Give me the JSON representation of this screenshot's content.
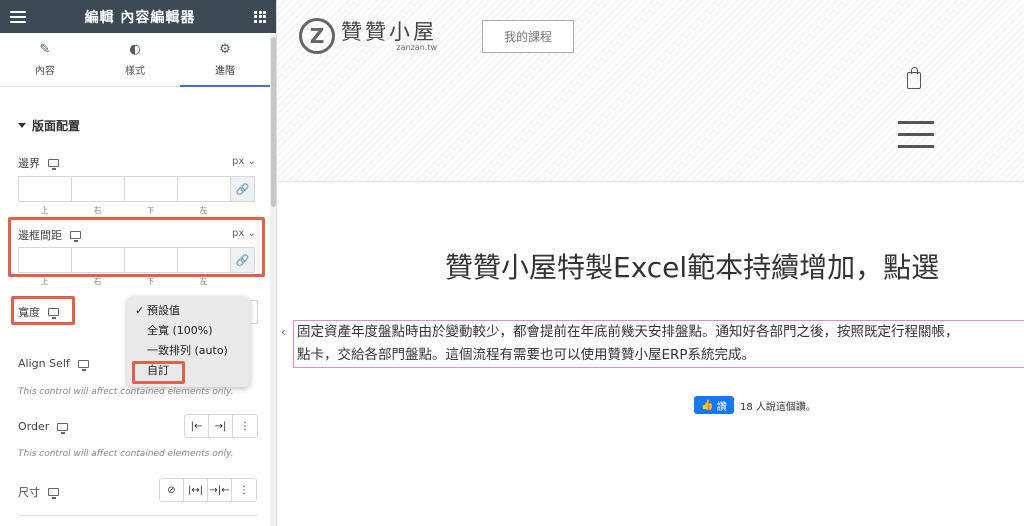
{
  "panel": {
    "title": "編輯 內容編輯器",
    "tabs": [
      {
        "label": "內容"
      },
      {
        "label": "樣式"
      },
      {
        "label": "進階"
      }
    ],
    "section_title": "版面配置",
    "margin": {
      "label": "邊界",
      "unit": "px ⌄",
      "sides": [
        "上",
        "右",
        "下",
        "左"
      ]
    },
    "padding": {
      "label": "邊框間距",
      "unit": "px ⌄",
      "sides": [
        "上",
        "右",
        "下",
        "左"
      ]
    },
    "width": {
      "label": "寬度",
      "options": [
        "預設值",
        "全寬 (100%)",
        "一致排列 (auto)",
        "自訂"
      ],
      "checked": "預設值",
      "highlighted": "自訂"
    },
    "align_self": {
      "label": "Align Self",
      "note": "This control will affect contained elements only."
    },
    "order": {
      "label": "Order",
      "note": "This control will affect contained elements only."
    },
    "size": {
      "label": "尺寸"
    }
  },
  "site": {
    "logo_text": "贊贊小屋",
    "logo_sub": "zanzan.tw",
    "nav_button": "我的課程",
    "title": "贊贊小屋特製Excel範本持續增加，點選",
    "para_line1": "固定資產年度盤點時由於變動較少，都會提前在年底前幾天安排盤點。通知好各部門之後，按照既定行程關帳，",
    "para_line2": "點卡，交給各部門盤點。這個流程有需要也可以使用贊贊小屋ERP系統完成。",
    "fb_button": "讚",
    "fb_text": "18 人說這個讚。"
  },
  "colors": {
    "accent": "#4b6bd6",
    "highlight": "#e0624a",
    "fb": "#1877f2"
  }
}
